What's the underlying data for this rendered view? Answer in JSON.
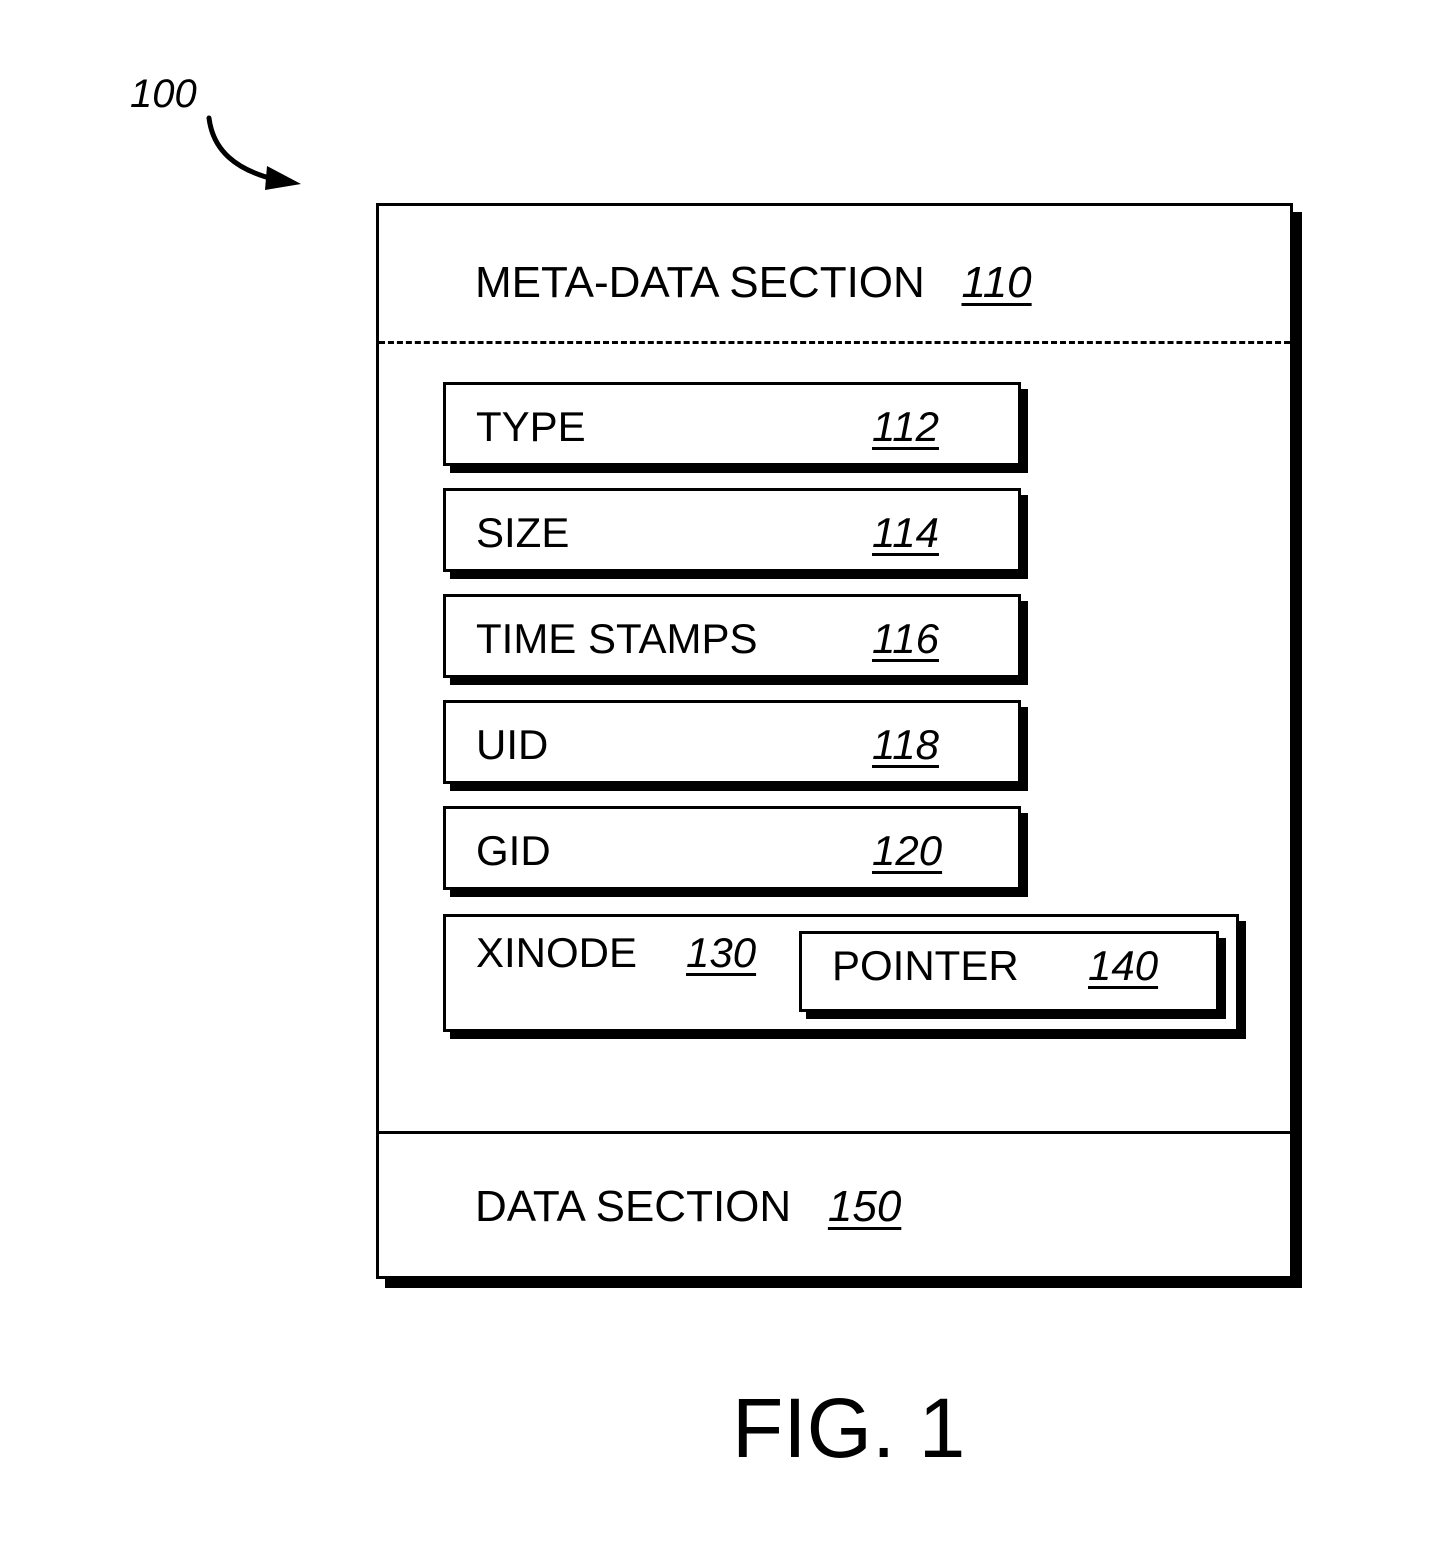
{
  "figure": {
    "reference_label": "100",
    "caption": "FIG. 1"
  },
  "meta_data_section": {
    "label": "META-DATA SECTION",
    "number": "110"
  },
  "fields": [
    {
      "label": "TYPE",
      "number": "112"
    },
    {
      "label": "SIZE",
      "number": "114"
    },
    {
      "label": "TIME STAMPS",
      "number": "116"
    },
    {
      "label": "UID",
      "number": "118"
    },
    {
      "label": "GID",
      "number": "120"
    }
  ],
  "xinode": {
    "label": "XINODE",
    "number": "130",
    "pointer": {
      "label": "POINTER",
      "number": "140"
    }
  },
  "data_section": {
    "label": "DATA SECTION",
    "number": "150"
  }
}
